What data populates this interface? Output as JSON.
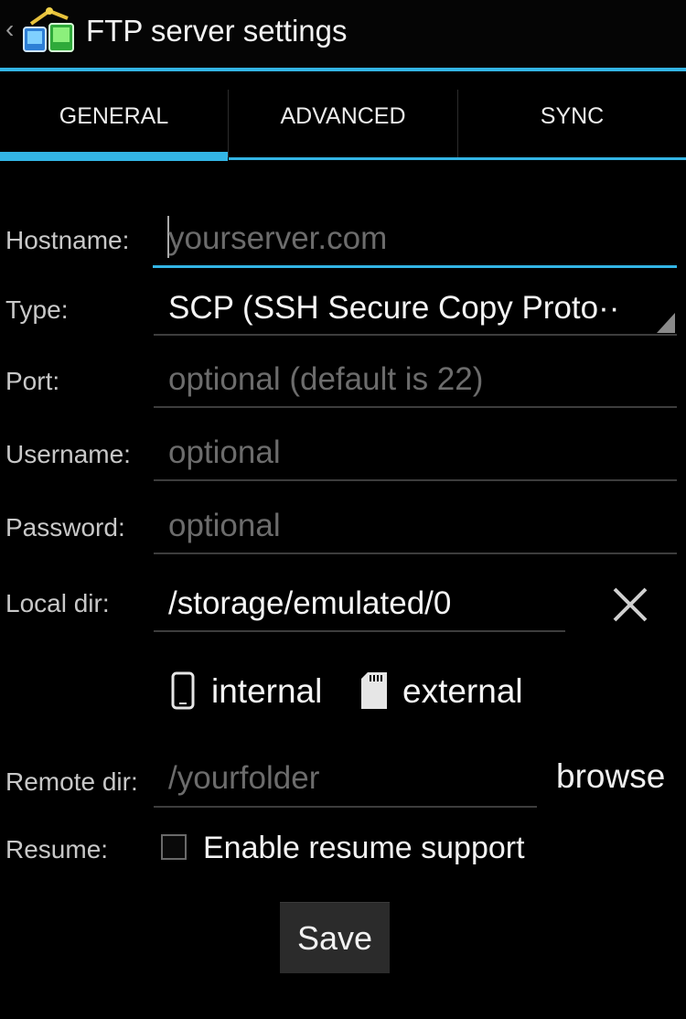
{
  "actionbar": {
    "title": "FTP server settings",
    "back_glyph": "‹",
    "icon": "app-icon",
    "accent": "#33b5e5"
  },
  "tabs": [
    {
      "label": "GENERAL",
      "active": true
    },
    {
      "label": "ADVANCED",
      "active": false
    },
    {
      "label": "SYNC",
      "active": false
    }
  ],
  "form": {
    "hostname": {
      "label": "Hostname:",
      "placeholder": "yourserver.com"
    },
    "type": {
      "label": "Type:",
      "value": "SCP (SSH Secure Copy Proto··"
    },
    "port": {
      "label": "Port:",
      "placeholder": "optional (default is 22)"
    },
    "username": {
      "label": "Username:",
      "placeholder": "optional"
    },
    "password": {
      "label": "Password:",
      "placeholder": "optional"
    },
    "local_dir": {
      "label": "Local dir:",
      "value": "/storage/emulated/0"
    },
    "storage": {
      "internal": "internal",
      "external": "external"
    },
    "remote_dir": {
      "label": "Remote dir:",
      "placeholder": "/yourfolder",
      "browse": "browse"
    },
    "resume": {
      "label": "Resume:",
      "checkbox_label": "Enable resume support",
      "checked": false
    }
  },
  "save_label": "Save"
}
